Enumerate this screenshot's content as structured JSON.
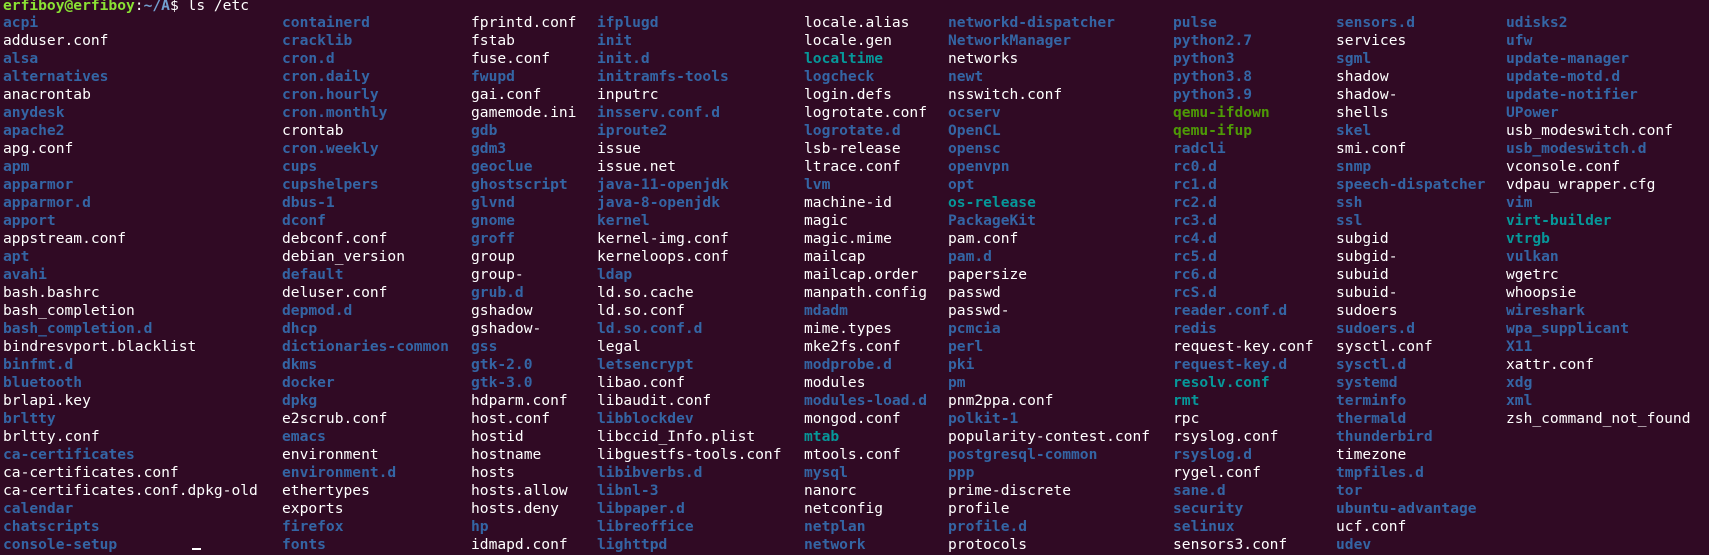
{
  "prompt": {
    "user_host": "erfiboy@erfiboy",
    "separator": ":",
    "path": "~/A",
    "symbol": "$ ",
    "command": "ls /etc"
  },
  "colors": {
    "background": "#300a24",
    "directory": "#3465a4",
    "symlink": "#06989a",
    "executable": "#4e9a06",
    "file": "#ffffff",
    "prompt_user": "#8ae234"
  },
  "columns": [
    [
      {
        "name": "acpi",
        "type": "dir"
      },
      {
        "name": "adduser.conf",
        "type": "file"
      },
      {
        "name": "alsa",
        "type": "dir"
      },
      {
        "name": "alternatives",
        "type": "dir"
      },
      {
        "name": "anacrontab",
        "type": "file"
      },
      {
        "name": "anydesk",
        "type": "dir"
      },
      {
        "name": "apache2",
        "type": "dir"
      },
      {
        "name": "apg.conf",
        "type": "file"
      },
      {
        "name": "apm",
        "type": "dir"
      },
      {
        "name": "apparmor",
        "type": "dir"
      },
      {
        "name": "apparmor.d",
        "type": "dir"
      },
      {
        "name": "apport",
        "type": "dir"
      },
      {
        "name": "appstream.conf",
        "type": "file"
      },
      {
        "name": "apt",
        "type": "dir"
      },
      {
        "name": "avahi",
        "type": "dir"
      },
      {
        "name": "bash.bashrc",
        "type": "file"
      },
      {
        "name": "bash_completion",
        "type": "file"
      },
      {
        "name": "bash_completion.d",
        "type": "dir"
      },
      {
        "name": "bindresvport.blacklist",
        "type": "file"
      },
      {
        "name": "binfmt.d",
        "type": "dir"
      },
      {
        "name": "bluetooth",
        "type": "dir"
      },
      {
        "name": "brlapi.key",
        "type": "file"
      },
      {
        "name": "brltty",
        "type": "dir"
      },
      {
        "name": "brltty.conf",
        "type": "file"
      },
      {
        "name": "ca-certificates",
        "type": "dir"
      },
      {
        "name": "ca-certificates.conf",
        "type": "file"
      },
      {
        "name": "ca-certificates.conf.dpkg-old",
        "type": "file"
      },
      {
        "name": "calendar",
        "type": "dir"
      },
      {
        "name": "chatscripts",
        "type": "dir"
      },
      {
        "name": "console-setup",
        "type": "dir"
      }
    ],
    [
      {
        "name": "containerd",
        "type": "dir"
      },
      {
        "name": "cracklib",
        "type": "dir"
      },
      {
        "name": "cron.d",
        "type": "dir"
      },
      {
        "name": "cron.daily",
        "type": "dir"
      },
      {
        "name": "cron.hourly",
        "type": "dir"
      },
      {
        "name": "cron.monthly",
        "type": "dir"
      },
      {
        "name": "crontab",
        "type": "file"
      },
      {
        "name": "cron.weekly",
        "type": "dir"
      },
      {
        "name": "cups",
        "type": "dir"
      },
      {
        "name": "cupshelpers",
        "type": "dir"
      },
      {
        "name": "dbus-1",
        "type": "dir"
      },
      {
        "name": "dconf",
        "type": "dir"
      },
      {
        "name": "debconf.conf",
        "type": "file"
      },
      {
        "name": "debian_version",
        "type": "file"
      },
      {
        "name": "default",
        "type": "dir"
      },
      {
        "name": "deluser.conf",
        "type": "file"
      },
      {
        "name": "depmod.d",
        "type": "dir"
      },
      {
        "name": "dhcp",
        "type": "dir"
      },
      {
        "name": "dictionaries-common",
        "type": "dir"
      },
      {
        "name": "dkms",
        "type": "dir"
      },
      {
        "name": "docker",
        "type": "dir"
      },
      {
        "name": "dpkg",
        "type": "dir"
      },
      {
        "name": "e2scrub.conf",
        "type": "file"
      },
      {
        "name": "emacs",
        "type": "dir"
      },
      {
        "name": "environment",
        "type": "file"
      },
      {
        "name": "environment.d",
        "type": "dir"
      },
      {
        "name": "ethertypes",
        "type": "file"
      },
      {
        "name": "exports",
        "type": "file"
      },
      {
        "name": "firefox",
        "type": "dir"
      },
      {
        "name": "fonts",
        "type": "dir"
      }
    ],
    [
      {
        "name": "fprintd.conf",
        "type": "file"
      },
      {
        "name": "fstab",
        "type": "file"
      },
      {
        "name": "fuse.conf",
        "type": "file"
      },
      {
        "name": "fwupd",
        "type": "dir"
      },
      {
        "name": "gai.conf",
        "type": "file"
      },
      {
        "name": "gamemode.ini",
        "type": "file"
      },
      {
        "name": "gdb",
        "type": "dir"
      },
      {
        "name": "gdm3",
        "type": "dir"
      },
      {
        "name": "geoclue",
        "type": "dir"
      },
      {
        "name": "ghostscript",
        "type": "dir"
      },
      {
        "name": "glvnd",
        "type": "dir"
      },
      {
        "name": "gnome",
        "type": "dir"
      },
      {
        "name": "groff",
        "type": "dir"
      },
      {
        "name": "group",
        "type": "file"
      },
      {
        "name": "group-",
        "type": "file"
      },
      {
        "name": "grub.d",
        "type": "dir"
      },
      {
        "name": "gshadow",
        "type": "file"
      },
      {
        "name": "gshadow-",
        "type": "file"
      },
      {
        "name": "gss",
        "type": "dir"
      },
      {
        "name": "gtk-2.0",
        "type": "dir"
      },
      {
        "name": "gtk-3.0",
        "type": "dir"
      },
      {
        "name": "hdparm.conf",
        "type": "file"
      },
      {
        "name": "host.conf",
        "type": "file"
      },
      {
        "name": "hostid",
        "type": "file"
      },
      {
        "name": "hostname",
        "type": "file"
      },
      {
        "name": "hosts",
        "type": "file"
      },
      {
        "name": "hosts.allow",
        "type": "file"
      },
      {
        "name": "hosts.deny",
        "type": "file"
      },
      {
        "name": "hp",
        "type": "dir"
      },
      {
        "name": "idmapd.conf",
        "type": "file"
      }
    ],
    [
      {
        "name": "ifplugd",
        "type": "dir"
      },
      {
        "name": "init",
        "type": "dir"
      },
      {
        "name": "init.d",
        "type": "dir"
      },
      {
        "name": "initramfs-tools",
        "type": "dir"
      },
      {
        "name": "inputrc",
        "type": "file"
      },
      {
        "name": "insserv.conf.d",
        "type": "dir"
      },
      {
        "name": "iproute2",
        "type": "dir"
      },
      {
        "name": "issue",
        "type": "file"
      },
      {
        "name": "issue.net",
        "type": "file"
      },
      {
        "name": "java-11-openjdk",
        "type": "dir"
      },
      {
        "name": "java-8-openjdk",
        "type": "dir"
      },
      {
        "name": "kernel",
        "type": "dir"
      },
      {
        "name": "kernel-img.conf",
        "type": "file"
      },
      {
        "name": "kerneloops.conf",
        "type": "file"
      },
      {
        "name": "ldap",
        "type": "dir"
      },
      {
        "name": "ld.so.cache",
        "type": "file"
      },
      {
        "name": "ld.so.conf",
        "type": "file"
      },
      {
        "name": "ld.so.conf.d",
        "type": "dir"
      },
      {
        "name": "legal",
        "type": "file"
      },
      {
        "name": "letsencrypt",
        "type": "dir"
      },
      {
        "name": "libao.conf",
        "type": "file"
      },
      {
        "name": "libaudit.conf",
        "type": "file"
      },
      {
        "name": "libblockdev",
        "type": "dir"
      },
      {
        "name": "libccid_Info.plist",
        "type": "file"
      },
      {
        "name": "libguestfs-tools.conf",
        "type": "file"
      },
      {
        "name": "libibverbs.d",
        "type": "dir"
      },
      {
        "name": "libnl-3",
        "type": "dir"
      },
      {
        "name": "libpaper.d",
        "type": "dir"
      },
      {
        "name": "libreoffice",
        "type": "dir"
      },
      {
        "name": "lighttpd",
        "type": "dir"
      }
    ],
    [
      {
        "name": "locale.alias",
        "type": "file"
      },
      {
        "name": "locale.gen",
        "type": "file"
      },
      {
        "name": "localtime",
        "type": "link"
      },
      {
        "name": "logcheck",
        "type": "dir"
      },
      {
        "name": "login.defs",
        "type": "file"
      },
      {
        "name": "logrotate.conf",
        "type": "file"
      },
      {
        "name": "logrotate.d",
        "type": "dir"
      },
      {
        "name": "lsb-release",
        "type": "file"
      },
      {
        "name": "ltrace.conf",
        "type": "file"
      },
      {
        "name": "lvm",
        "type": "dir"
      },
      {
        "name": "machine-id",
        "type": "file"
      },
      {
        "name": "magic",
        "type": "file"
      },
      {
        "name": "magic.mime",
        "type": "file"
      },
      {
        "name": "mailcap",
        "type": "file"
      },
      {
        "name": "mailcap.order",
        "type": "file"
      },
      {
        "name": "manpath.config",
        "type": "file"
      },
      {
        "name": "mdadm",
        "type": "dir"
      },
      {
        "name": "mime.types",
        "type": "file"
      },
      {
        "name": "mke2fs.conf",
        "type": "file"
      },
      {
        "name": "modprobe.d",
        "type": "dir"
      },
      {
        "name": "modules",
        "type": "file"
      },
      {
        "name": "modules-load.d",
        "type": "dir"
      },
      {
        "name": "mongod.conf",
        "type": "file"
      },
      {
        "name": "mtab",
        "type": "link"
      },
      {
        "name": "mtools.conf",
        "type": "file"
      },
      {
        "name": "mysql",
        "type": "dir"
      },
      {
        "name": "nanorc",
        "type": "file"
      },
      {
        "name": "netconfig",
        "type": "file"
      },
      {
        "name": "netplan",
        "type": "dir"
      },
      {
        "name": "network",
        "type": "dir"
      }
    ],
    [
      {
        "name": "networkd-dispatcher",
        "type": "dir"
      },
      {
        "name": "NetworkManager",
        "type": "dir"
      },
      {
        "name": "networks",
        "type": "file"
      },
      {
        "name": "newt",
        "type": "dir"
      },
      {
        "name": "nsswitch.conf",
        "type": "file"
      },
      {
        "name": "ocserv",
        "type": "dir"
      },
      {
        "name": "OpenCL",
        "type": "dir"
      },
      {
        "name": "opensc",
        "type": "dir"
      },
      {
        "name": "openvpn",
        "type": "dir"
      },
      {
        "name": "opt",
        "type": "dir"
      },
      {
        "name": "os-release",
        "type": "link"
      },
      {
        "name": "PackageKit",
        "type": "dir"
      },
      {
        "name": "pam.conf",
        "type": "file"
      },
      {
        "name": "pam.d",
        "type": "dir"
      },
      {
        "name": "papersize",
        "type": "file"
      },
      {
        "name": "passwd",
        "type": "file"
      },
      {
        "name": "passwd-",
        "type": "file"
      },
      {
        "name": "pcmcia",
        "type": "dir"
      },
      {
        "name": "perl",
        "type": "dir"
      },
      {
        "name": "pki",
        "type": "dir"
      },
      {
        "name": "pm",
        "type": "dir"
      },
      {
        "name": "pnm2ppa.conf",
        "type": "file"
      },
      {
        "name": "polkit-1",
        "type": "dir"
      },
      {
        "name": "popularity-contest.conf",
        "type": "file"
      },
      {
        "name": "postgresql-common",
        "type": "dir"
      },
      {
        "name": "ppp",
        "type": "dir"
      },
      {
        "name": "prime-discrete",
        "type": "file"
      },
      {
        "name": "profile",
        "type": "file"
      },
      {
        "name": "profile.d",
        "type": "dir"
      },
      {
        "name": "protocols",
        "type": "file"
      }
    ],
    [
      {
        "name": "pulse",
        "type": "dir"
      },
      {
        "name": "python2.7",
        "type": "dir"
      },
      {
        "name": "python3",
        "type": "dir"
      },
      {
        "name": "python3.8",
        "type": "dir"
      },
      {
        "name": "python3.9",
        "type": "dir"
      },
      {
        "name": "qemu-ifdown",
        "type": "exec"
      },
      {
        "name": "qemu-ifup",
        "type": "exec"
      },
      {
        "name": "radcli",
        "type": "dir"
      },
      {
        "name": "rc0.d",
        "type": "dir"
      },
      {
        "name": "rc1.d",
        "type": "dir"
      },
      {
        "name": "rc2.d",
        "type": "dir"
      },
      {
        "name": "rc3.d",
        "type": "dir"
      },
      {
        "name": "rc4.d",
        "type": "dir"
      },
      {
        "name": "rc5.d",
        "type": "dir"
      },
      {
        "name": "rc6.d",
        "type": "dir"
      },
      {
        "name": "rcS.d",
        "type": "dir"
      },
      {
        "name": "reader.conf.d",
        "type": "dir"
      },
      {
        "name": "redis",
        "type": "dir"
      },
      {
        "name": "request-key.conf",
        "type": "file"
      },
      {
        "name": "request-key.d",
        "type": "dir"
      },
      {
        "name": "resolv.conf",
        "type": "link"
      },
      {
        "name": "rmt",
        "type": "link"
      },
      {
        "name": "rpc",
        "type": "file"
      },
      {
        "name": "rsyslog.conf",
        "type": "file"
      },
      {
        "name": "rsyslog.d",
        "type": "dir"
      },
      {
        "name": "rygel.conf",
        "type": "file"
      },
      {
        "name": "sane.d",
        "type": "dir"
      },
      {
        "name": "security",
        "type": "dir"
      },
      {
        "name": "selinux",
        "type": "dir"
      },
      {
        "name": "sensors3.conf",
        "type": "file"
      }
    ],
    [
      {
        "name": "sensors.d",
        "type": "dir"
      },
      {
        "name": "services",
        "type": "file"
      },
      {
        "name": "sgml",
        "type": "dir"
      },
      {
        "name": "shadow",
        "type": "file"
      },
      {
        "name": "shadow-",
        "type": "file"
      },
      {
        "name": "shells",
        "type": "file"
      },
      {
        "name": "skel",
        "type": "dir"
      },
      {
        "name": "smi.conf",
        "type": "file"
      },
      {
        "name": "snmp",
        "type": "dir"
      },
      {
        "name": "speech-dispatcher",
        "type": "dir"
      },
      {
        "name": "ssh",
        "type": "dir"
      },
      {
        "name": "ssl",
        "type": "dir"
      },
      {
        "name": "subgid",
        "type": "file"
      },
      {
        "name": "subgid-",
        "type": "file"
      },
      {
        "name": "subuid",
        "type": "file"
      },
      {
        "name": "subuid-",
        "type": "file"
      },
      {
        "name": "sudoers",
        "type": "file"
      },
      {
        "name": "sudoers.d",
        "type": "dir"
      },
      {
        "name": "sysctl.conf",
        "type": "file"
      },
      {
        "name": "sysctl.d",
        "type": "dir"
      },
      {
        "name": "systemd",
        "type": "dir"
      },
      {
        "name": "terminfo",
        "type": "dir"
      },
      {
        "name": "thermald",
        "type": "dir"
      },
      {
        "name": "thunderbird",
        "type": "dir"
      },
      {
        "name": "timezone",
        "type": "file"
      },
      {
        "name": "tmpfiles.d",
        "type": "dir"
      },
      {
        "name": "tor",
        "type": "dir"
      },
      {
        "name": "ubuntu-advantage",
        "type": "dir"
      },
      {
        "name": "ucf.conf",
        "type": "file"
      },
      {
        "name": "udev",
        "type": "dir"
      }
    ],
    [
      {
        "name": "udisks2",
        "type": "dir"
      },
      {
        "name": "ufw",
        "type": "dir"
      },
      {
        "name": "update-manager",
        "type": "dir"
      },
      {
        "name": "update-motd.d",
        "type": "dir"
      },
      {
        "name": "update-notifier",
        "type": "dir"
      },
      {
        "name": "UPower",
        "type": "dir"
      },
      {
        "name": "usb_modeswitch.conf",
        "type": "file"
      },
      {
        "name": "usb_modeswitch.d",
        "type": "dir"
      },
      {
        "name": "vconsole.conf",
        "type": "file"
      },
      {
        "name": "vdpau_wrapper.cfg",
        "type": "file"
      },
      {
        "name": "vim",
        "type": "dir"
      },
      {
        "name": "virt-builder",
        "type": "link"
      },
      {
        "name": "vtrgb",
        "type": "link"
      },
      {
        "name": "vulkan",
        "type": "dir"
      },
      {
        "name": "wgetrc",
        "type": "file"
      },
      {
        "name": "whoopsie",
        "type": "file"
      },
      {
        "name": "wireshark",
        "type": "dir"
      },
      {
        "name": "wpa_supplicant",
        "type": "dir"
      },
      {
        "name": "X11",
        "type": "dir"
      },
      {
        "name": "xattr.conf",
        "type": "file"
      },
      {
        "name": "xdg",
        "type": "dir"
      },
      {
        "name": "xml",
        "type": "dir"
      },
      {
        "name": "zsh_command_not_found",
        "type": "file"
      }
    ]
  ]
}
